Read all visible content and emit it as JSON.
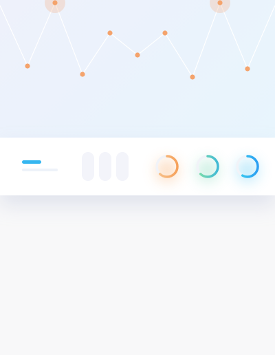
{
  "hero_chart": {
    "type": "line",
    "line_color": "#ffffff",
    "point_color": "#f4a36c",
    "highlight_color": "#f4b48a",
    "points": [
      {
        "x": 0,
        "y": 96
      },
      {
        "x": 1,
        "y": 52
      },
      {
        "x": 2,
        "y": 98
      },
      {
        "x": 3,
        "y": 46
      },
      {
        "x": 4,
        "y": 76
      },
      {
        "x": 5,
        "y": 60
      },
      {
        "x": 6,
        "y": 76
      },
      {
        "x": 7,
        "y": 44
      },
      {
        "x": 8,
        "y": 98
      },
      {
        "x": 9,
        "y": 50
      },
      {
        "x": 10,
        "y": 96
      }
    ],
    "highlighted_indices": [
      2,
      8
    ]
  },
  "summary_card": {
    "accent_color": "#35b6f0",
    "placeholder_color": "#eef2f9",
    "pill_color": "#f3f4fa",
    "pill_count": 3,
    "rings": [
      {
        "name": "orange-ring",
        "fraction": 0.62,
        "colors": [
          "#f7c48f",
          "#f6a15a"
        ],
        "glow": "#f9b57a"
      },
      {
        "name": "green-ring",
        "fraction": 0.62,
        "colors": [
          "#7fe0a6",
          "#40b9d6"
        ],
        "glow": "#8ddcc0"
      },
      {
        "name": "blue-ring",
        "fraction": 0.58,
        "colors": [
          "#38d0ef",
          "#2b9ef2"
        ],
        "glow": "#6fd0f4"
      }
    ]
  }
}
